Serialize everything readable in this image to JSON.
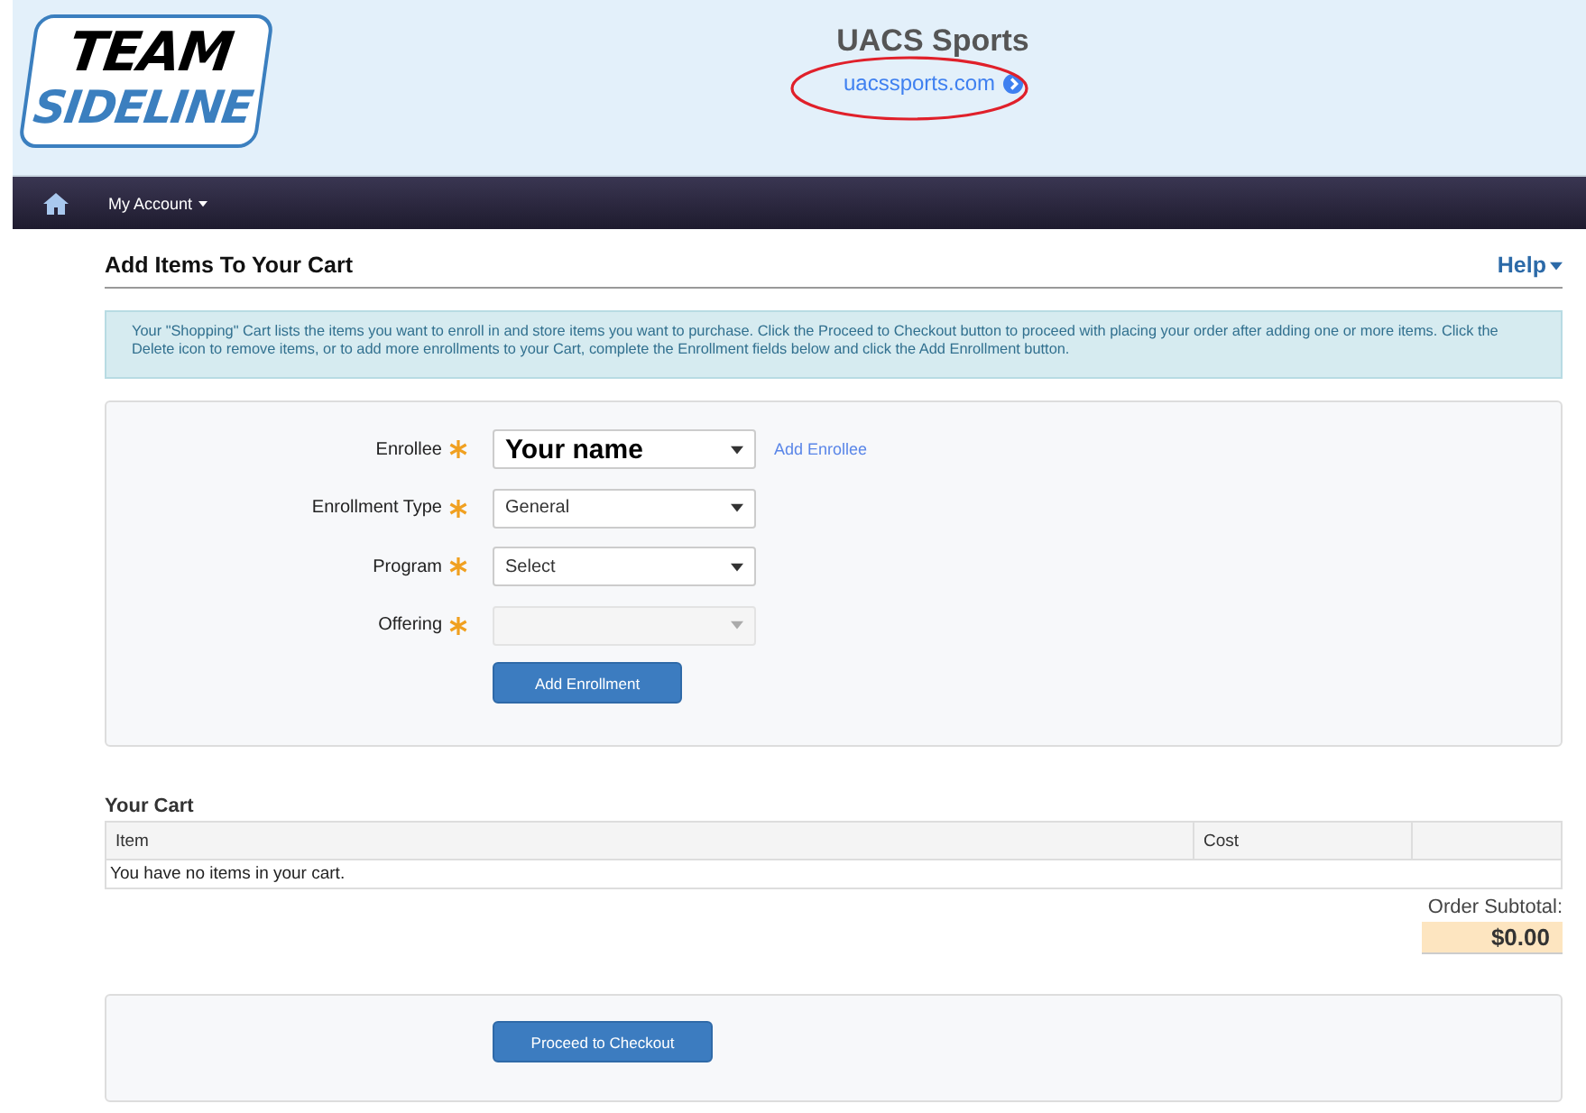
{
  "header": {
    "logo": [
      "TEAM",
      "SIDELINE"
    ],
    "org_name": "UACS Sports",
    "org_link": "uacssports.com"
  },
  "nav": {
    "items": [
      {
        "label": "My Account",
        "has_menu": true
      }
    ]
  },
  "page": {
    "title": "Add Items To Your Cart",
    "help": "Help"
  },
  "info": "Your \"Shopping\" Cart lists the items you want to enroll in and store items you want to purchase. Click the Proceed to Checkout button to proceed with placing your order after adding one or more items. Click the Delete icon to remove items, or to add more enrollments to your Cart, complete the Enrollment fields below and click the Add Enrollment button.",
  "form": {
    "fields": [
      {
        "label": "Enrollee",
        "required": true,
        "value": "Your name",
        "disabled": false,
        "emphasis": true,
        "link": "Add Enrollee"
      },
      {
        "label": "Enrollment Type",
        "required": true,
        "value": "General",
        "disabled": false,
        "emphasis": false
      },
      {
        "label": "Program",
        "required": true,
        "value": "Select",
        "disabled": false,
        "emphasis": false
      },
      {
        "label": "Offering",
        "required": true,
        "disabled": true,
        "emphasis": false
      }
    ],
    "button": "Add Enrollment"
  },
  "cart": {
    "title": "Your Cart",
    "columns": [
      "Item",
      "Cost"
    ],
    "empty_message": "You have no items in your cart.",
    "subtotal_label": "Order Subtotal:",
    "subtotal": "$0.00"
  },
  "checkout_button": "Proceed to Checkout"
}
